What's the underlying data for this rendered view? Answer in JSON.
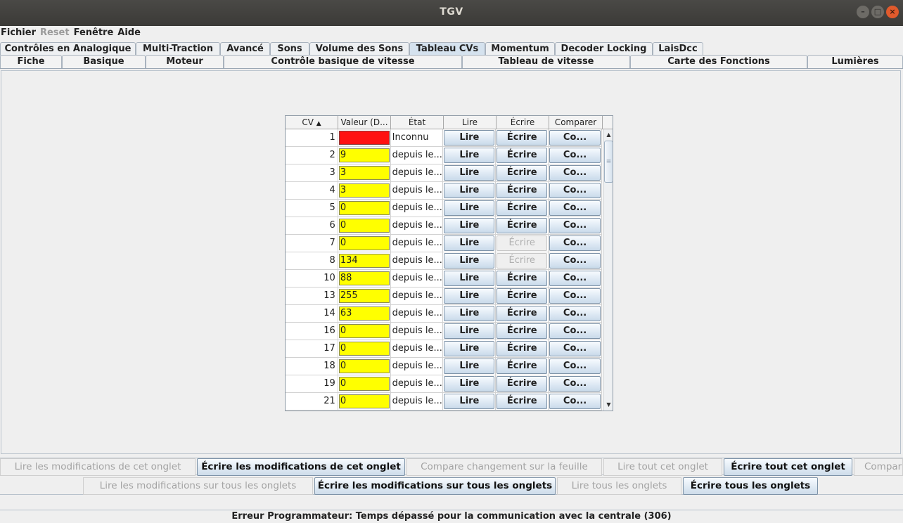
{
  "window": {
    "title": "TGV"
  },
  "menu": {
    "items": [
      {
        "label": "Fichier",
        "enabled": true
      },
      {
        "label": "Reset",
        "enabled": false
      },
      {
        "label": "Fenêtre",
        "enabled": true
      },
      {
        "label": "Aide",
        "enabled": true
      }
    ]
  },
  "tabs_row1": [
    "Contrôles en Analogique",
    "Multi-Traction",
    "Avancé",
    "Sons",
    "Volume des Sons",
    "Tableau CVs",
    "Momentum",
    "Decoder Locking",
    "LaisDcc"
  ],
  "tabs_row1_active": "Tableau CVs",
  "tabs_row2": [
    "Fiche",
    "Basique",
    "Moteur",
    "Contrôle basique de vitesse",
    "Tableau de vitesse",
    "Carte des Fonctions",
    "Lumières"
  ],
  "table": {
    "headers": [
      "CV",
      "Valeur (D...",
      "État",
      "Lire",
      "Écrire",
      "Comparer"
    ],
    "sort_indicator": "▲",
    "rows": [
      {
        "cv": "1",
        "value": "",
        "state": "Inconnu",
        "read": "Lire",
        "write": "Écrire",
        "compare": "Co..."
      },
      {
        "cv": "2",
        "value": "9",
        "state": "depuis le...",
        "read": "Lire",
        "write": "Écrire",
        "compare": "Co..."
      },
      {
        "cv": "3",
        "value": "3",
        "state": "depuis le...",
        "read": "Lire",
        "write": "Écrire",
        "compare": "Co..."
      },
      {
        "cv": "4",
        "value": "3",
        "state": "depuis le...",
        "read": "Lire",
        "write": "Écrire",
        "compare": "Co..."
      },
      {
        "cv": "5",
        "value": "0",
        "state": "depuis le...",
        "read": "Lire",
        "write": "Écrire",
        "compare": "Co..."
      },
      {
        "cv": "6",
        "value": "0",
        "state": "depuis le...",
        "read": "Lire",
        "write": "Écrire",
        "compare": "Co..."
      },
      {
        "cv": "7",
        "value": "0",
        "state": "depuis le...",
        "read": "Lire",
        "write": "Écrire",
        "compare": "Co..."
      },
      {
        "cv": "8",
        "value": "134",
        "state": "depuis le...",
        "read": "Lire",
        "write": "Écrire",
        "compare": "Co..."
      },
      {
        "cv": "10",
        "value": "88",
        "state": "depuis le...",
        "read": "Lire",
        "write": "Écrire",
        "compare": "Co..."
      },
      {
        "cv": "13",
        "value": "255",
        "state": "depuis le...",
        "read": "Lire",
        "write": "Écrire",
        "compare": "Co..."
      },
      {
        "cv": "14",
        "value": "63",
        "state": "depuis le...",
        "read": "Lire",
        "write": "Écrire",
        "compare": "Co..."
      },
      {
        "cv": "16",
        "value": "0",
        "state": "depuis le...",
        "read": "Lire",
        "write": "Écrire",
        "compare": "Co..."
      },
      {
        "cv": "17",
        "value": "0",
        "state": "depuis le...",
        "read": "Lire",
        "write": "Écrire",
        "compare": "Co..."
      },
      {
        "cv": "18",
        "value": "0",
        "state": "depuis le...",
        "read": "Lire",
        "write": "Écrire",
        "compare": "Co..."
      },
      {
        "cv": "19",
        "value": "0",
        "state": "depuis le...",
        "read": "Lire",
        "write": "Écrire",
        "compare": "Co..."
      },
      {
        "cv": "21",
        "value": "0",
        "state": "depuis le...",
        "read": "Lire",
        "write": "Écrire",
        "compare": "Co..."
      }
    ],
    "disabled_write_rows": [
      "7",
      "8"
    ],
    "colors": {
      "unknown": "#ff1111",
      "from_file": "#ffff00"
    }
  },
  "bottom_row1": [
    {
      "label": "Lire les modifications de cet onglet",
      "enabled": false
    },
    {
      "label": "Écrire les modifications de cet onglet",
      "enabled": true
    },
    {
      "label": "Compare changement sur la feuille",
      "enabled": false
    },
    {
      "label": "Lire tout cet onglet",
      "enabled": false
    },
    {
      "label": "Écrire tout cet onglet",
      "enabled": true
    },
    {
      "label": "Compar",
      "enabled": false
    }
  ],
  "bottom_row2": [
    {
      "label": "Lire les modifications sur tous les onglets",
      "enabled": false
    },
    {
      "label": "Écrire les modifications sur tous les onglets",
      "enabled": true
    },
    {
      "label": "Lire tous les onglets",
      "enabled": false
    },
    {
      "label": "Écrire tous les onglets",
      "enabled": true
    }
  ],
  "status": "Erreur Programmateur: Temps dépassé pour la communication avec la centrale (306)"
}
